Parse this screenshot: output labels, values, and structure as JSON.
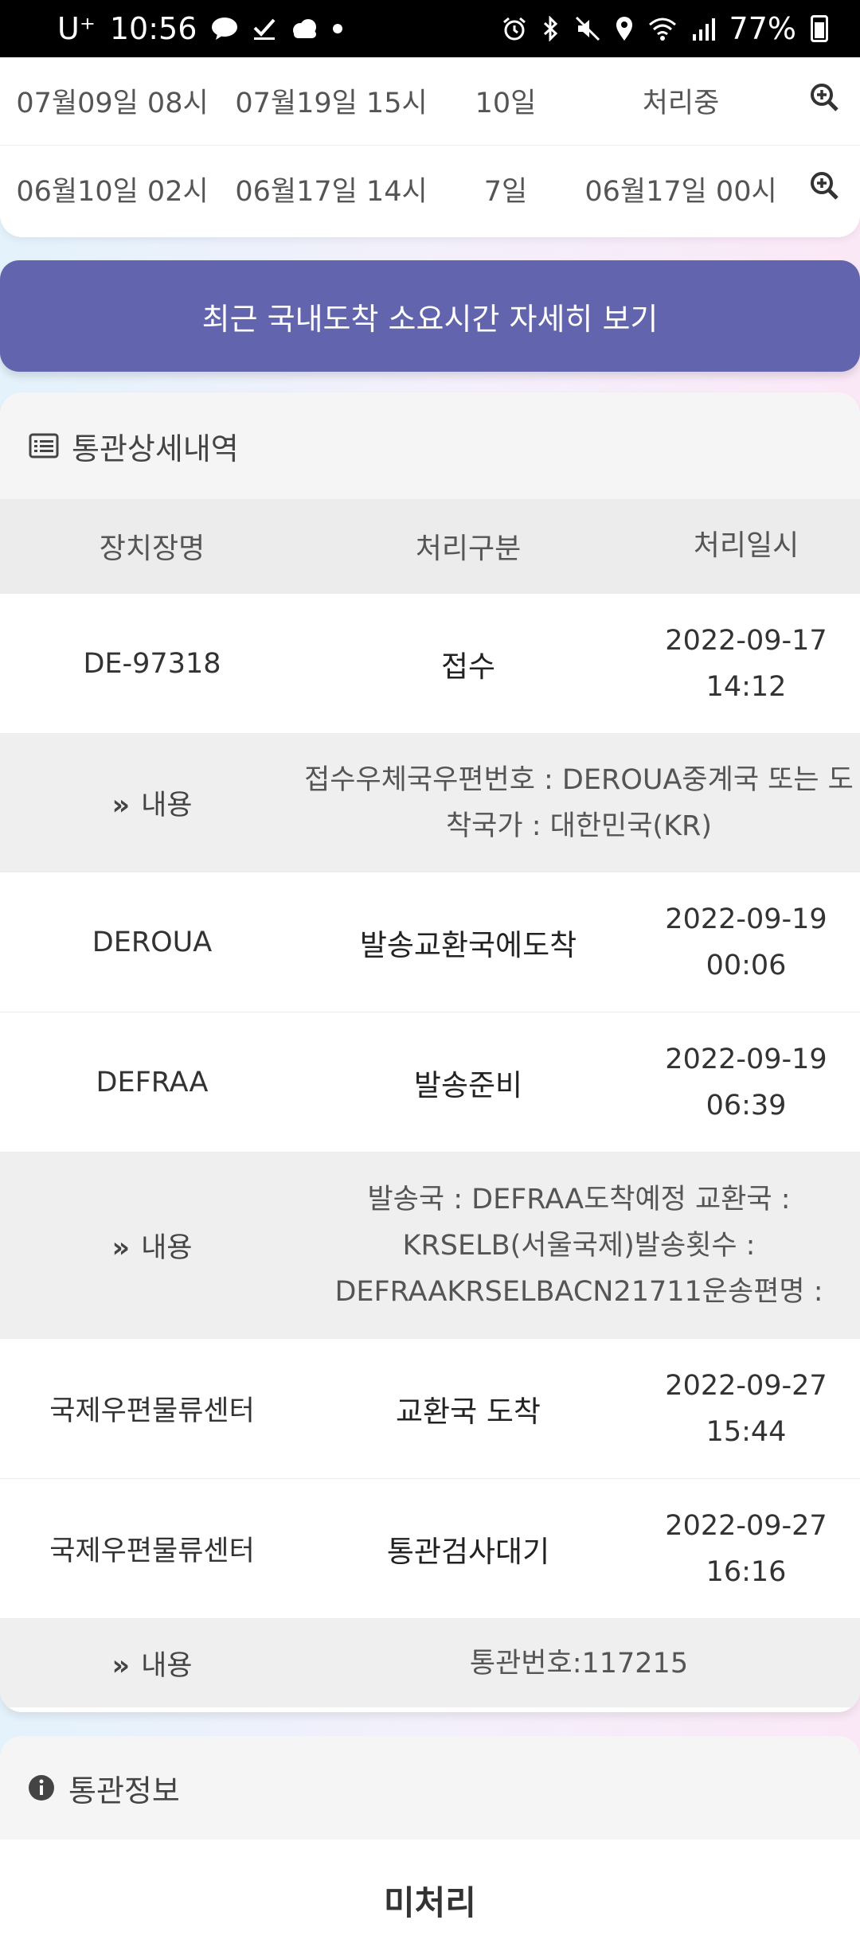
{
  "status_bar": {
    "carrier": "U⁺",
    "time": "10:56",
    "battery": "77%"
  },
  "top_rows": [
    {
      "start": "07월09일 08시",
      "end": "07월19일 15시",
      "days": "10일",
      "status": "처리중"
    },
    {
      "start": "06월10일 02시",
      "end": "06월17일 14시",
      "days": "7일",
      "status": "06월17일 00시"
    }
  ],
  "recent_button": {
    "label": "최근 국내도착 소요시간 자세히 보기"
  },
  "detail_section": {
    "title": "통관상세내역",
    "columns": [
      "장치장명",
      "처리구분",
      "처리일시"
    ],
    "detail_label": "내용",
    "rows": [
      {
        "place": "DE-97318",
        "type": "접수",
        "date": "2022-09-17",
        "time": "14:12"
      },
      {
        "detail": "접수우체국우편번호 : DEROUA중계국 또는 도착국가 : 대한민국(KR)"
      },
      {
        "place": "DEROUA",
        "type": "발송교환국에도착",
        "date": "2022-09-19",
        "time": "00:06"
      },
      {
        "place": "DEFRAA",
        "type": "발송준비",
        "date": "2022-09-19",
        "time": "06:39"
      },
      {
        "detail": "발송국 : DEFRAA도착예정 교환국 : KRSELB(서울국제)발송횟수 : DEFRAAKRSELBACN21711운송편명 :"
      },
      {
        "place": "국제우편물류센터",
        "type": "교환국 도착",
        "date": "2022-09-27",
        "time": "15:44"
      },
      {
        "place": "국제우편물류센터",
        "type": "통관검사대기",
        "date": "2022-09-27",
        "time": "16:16"
      },
      {
        "detail": "통관번호:117215"
      }
    ]
  },
  "info_section": {
    "title": "통관정보",
    "value": "미처리"
  },
  "colors": {
    "button": "#6265ad",
    "header_bg": "#f5f5f5",
    "column_header_bg": "#ececec",
    "detail_row_bg": "#efefef"
  }
}
